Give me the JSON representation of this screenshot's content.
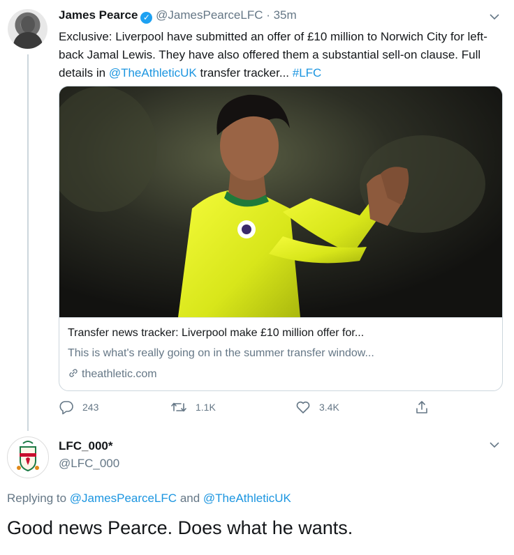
{
  "tweet": {
    "author_name": "James Pearce",
    "handle": "@JamesPearceLFC",
    "separator": " · ",
    "time": "35m",
    "text_part1": "Exclusive: Liverpool have submitted an offer of £10 million to Norwich City for left-back Jamal Lewis. They have also offered them a substantial sell-on clause. Full details in ",
    "mention": "@TheAthleticUK",
    "text_part2": " transfer tracker... ",
    "hashtag": "#LFC",
    "card": {
      "title": "Transfer news tracker: Liverpool make £10 million offer for...",
      "description": "This is what's really going on in the summer transfer window...",
      "domain": "theathletic.com"
    },
    "actions": {
      "replies": "243",
      "retweets": "1.1K",
      "likes": "3.4K"
    }
  },
  "reply": {
    "author_name": "LFC_000*",
    "handle": "@LFC_000",
    "replying_prefix": "Replying to ",
    "replying_to_1": "@JamesPearceLFC",
    "replying_and": " and ",
    "replying_to_2": "@TheAthleticUK",
    "text": "Good news Pearce. Does what he wants."
  },
  "colors": {
    "link": "#1b95e0",
    "verified": "#1da1f2",
    "muted": "#657786",
    "shirt": "#e6f21a"
  },
  "icons": [
    "verified-badge-icon",
    "chevron-down-icon",
    "link-icon",
    "reply-icon",
    "retweet-icon",
    "like-icon",
    "share-icon"
  ]
}
